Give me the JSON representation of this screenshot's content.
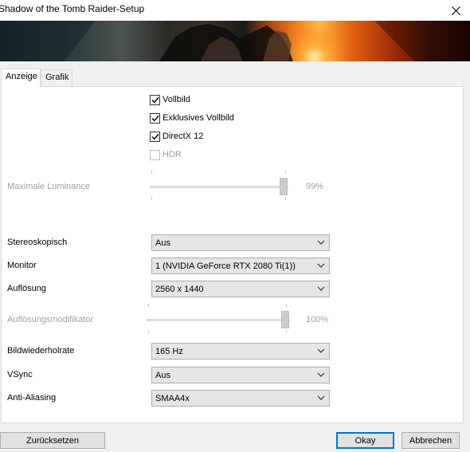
{
  "window": {
    "title": "Shadow of the Tomb Raider-Setup"
  },
  "tabs": [
    {
      "label": "Anzeige",
      "active": true
    },
    {
      "label": "Grafik",
      "active": false
    }
  ],
  "checkboxes": [
    {
      "label": "Vollbild",
      "checked": true,
      "enabled": true
    },
    {
      "label": "Exklusives Vollbild",
      "checked": true,
      "enabled": true
    },
    {
      "label": "DirectX 12",
      "checked": true,
      "enabled": true
    },
    {
      "label": "HDR",
      "checked": false,
      "enabled": false
    }
  ],
  "sliders": {
    "luminance": {
      "label": "Maximale Luminance",
      "value_text": "99%",
      "value": 0.99,
      "enabled": false
    },
    "resolution_modifier": {
      "label": "Auflösungsmodifikator",
      "value_text": "100%",
      "value": 1.0,
      "enabled": false
    }
  },
  "selects": {
    "stereo": {
      "label": "Stereoskopisch",
      "value": "Aus"
    },
    "monitor": {
      "label": "Monitor",
      "value": "1 (NVIDIA GeForce RTX 2080 Ti(1))"
    },
    "resolution": {
      "label": "Auflösung",
      "value": "2560 x 1440"
    },
    "refresh": {
      "label": "Bildwiederholrate",
      "value": "165 Hz"
    },
    "vsync": {
      "label": "VSync",
      "value": "Aus"
    },
    "antialiasing": {
      "label": "Anti-Aliasing",
      "value": "SMAA4x"
    }
  },
  "buttons": {
    "reset": "Zurücksetzen",
    "ok": "Okay",
    "cancel": "Abbrechen"
  }
}
